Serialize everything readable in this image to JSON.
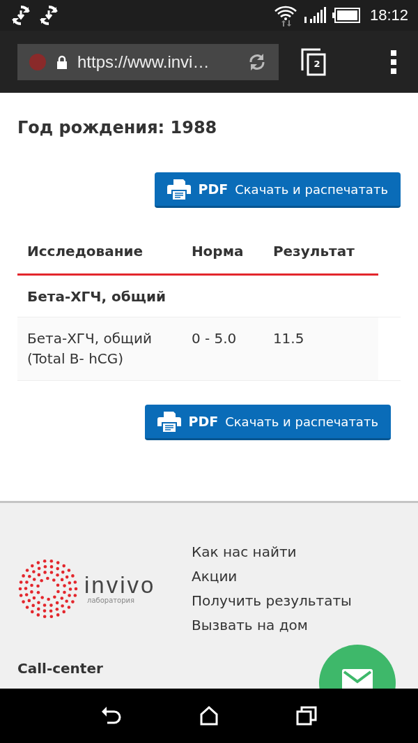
{
  "status_bar": {
    "time": "18:12"
  },
  "browser": {
    "url": "https://www.invi…",
    "tab_count": "2"
  },
  "patient": {
    "birth_year": "Год рождения: 1988"
  },
  "top_button": {
    "badge": "PDF",
    "label": "Скачать и распечатать"
  },
  "table": {
    "columns": [
      "Исследование",
      "Норма",
      "Результат"
    ],
    "groups": [
      {
        "title": "Бета-ХГЧ, общий",
        "rows": [
          {
            "test": "Бета-ХГЧ, общий\n(Total B- hCG)",
            "norm": "0 - 5.0",
            "result": "11.5"
          }
        ]
      }
    ]
  },
  "bottom_button": {
    "badge": "PDF",
    "label": "Скачать и распечатать"
  },
  "footer": {
    "logo": {
      "name": "invivo",
      "subtitle": "лаборатория"
    },
    "links": [
      "Как нас найти",
      "Акции",
      "Получить результаты",
      "Вызвать на дом"
    ],
    "call_center": "Call-center"
  }
}
